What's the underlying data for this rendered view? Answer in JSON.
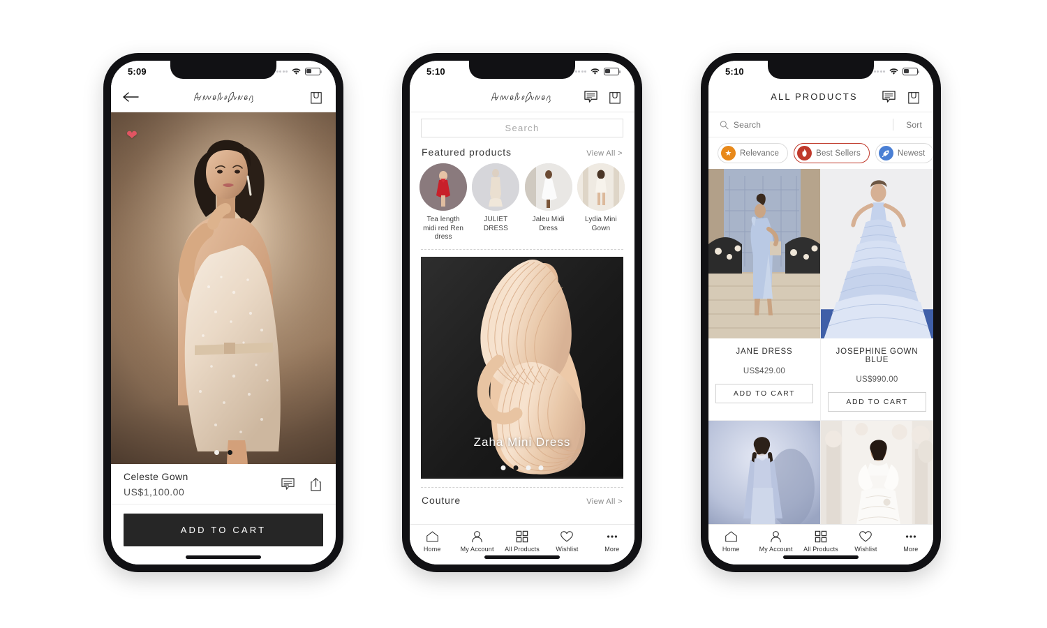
{
  "brand": "AmelieBaku",
  "phone1": {
    "status": {
      "time": "5:09",
      "wifi_icon": "wifi-icon",
      "battery_icon": "battery-icon",
      "cellular_icon": "cellular-dots-icon"
    },
    "header": {
      "back_icon": "back-arrow-icon",
      "logo": "AmelieBaku",
      "bag_icon": "shopping-bag-icon"
    },
    "hero": {
      "favorite_icon": "heart-icon",
      "dots_total": 2,
      "dots_active": 2
    },
    "product": {
      "name": "Celeste Gown",
      "price": "US$1,100.00",
      "chat_icon": "chat-bubble-icon",
      "share_icon": "share-icon"
    },
    "add_to_cart_label": "ADD TO CART"
  },
  "phone2": {
    "status": {
      "time": "5:10"
    },
    "header": {
      "logo": "AmelieBaku",
      "chat_icon": "chat-bubble-icon",
      "bag_icon": "shopping-bag-icon"
    },
    "search": {
      "placeholder": "Search",
      "value": ""
    },
    "featured": {
      "title": "Featured products",
      "view_all": "View All >",
      "items": [
        {
          "label": "Tea length midi red Ren dress"
        },
        {
          "label": "JULIET DRESS"
        },
        {
          "label": "Jaleu Midi Dress"
        },
        {
          "label": "Lydia Mini Gown"
        }
      ]
    },
    "banner": {
      "caption": "Zaha Mini Dress",
      "dots_total": 4,
      "dots_active": 2
    },
    "couture": {
      "title": "Couture",
      "view_all": "View All >"
    },
    "tabs": [
      {
        "label": "Home",
        "icon": "home-icon"
      },
      {
        "label": "My Account",
        "icon": "person-icon"
      },
      {
        "label": "All Products",
        "icon": "grid-icon"
      },
      {
        "label": "Wishlist",
        "icon": "heart-outline-icon"
      },
      {
        "label": "More",
        "icon": "ellipsis-icon"
      }
    ]
  },
  "phone3": {
    "status": {
      "time": "5:10"
    },
    "header": {
      "title": "ALL PRODUCTS",
      "chat_icon": "chat-bubble-icon",
      "bag_icon": "shopping-bag-icon"
    },
    "search": {
      "placeholder": "Search",
      "value": "",
      "icon": "search-icon",
      "sort_label": "Sort"
    },
    "chips": [
      {
        "label": "Relevance",
        "icon": "star-icon",
        "color": "#e8891a",
        "active": false
      },
      {
        "label": "Best Sellers",
        "icon": "flame-icon",
        "color": "#c0392b",
        "active": true
      },
      {
        "label": "Newest",
        "icon": "rocket-icon",
        "color": "#4a7fd4",
        "active": false
      }
    ],
    "products": [
      {
        "name": "JANE DRESS",
        "price": "US$429.00",
        "button": "ADD TO CART"
      },
      {
        "name": "JOSEPHINE GOWN BLUE",
        "price": "US$990.00",
        "button": "ADD TO CART"
      },
      {
        "name": "",
        "price": "",
        "button": ""
      },
      {
        "name": "",
        "price": "",
        "button": ""
      }
    ],
    "tabs": [
      {
        "label": "Home",
        "icon": "home-icon"
      },
      {
        "label": "My Account",
        "icon": "person-icon"
      },
      {
        "label": "All Products",
        "icon": "grid-icon"
      },
      {
        "label": "Wishlist",
        "icon": "heart-outline-icon"
      },
      {
        "label": "More",
        "icon": "ellipsis-icon"
      }
    ]
  }
}
